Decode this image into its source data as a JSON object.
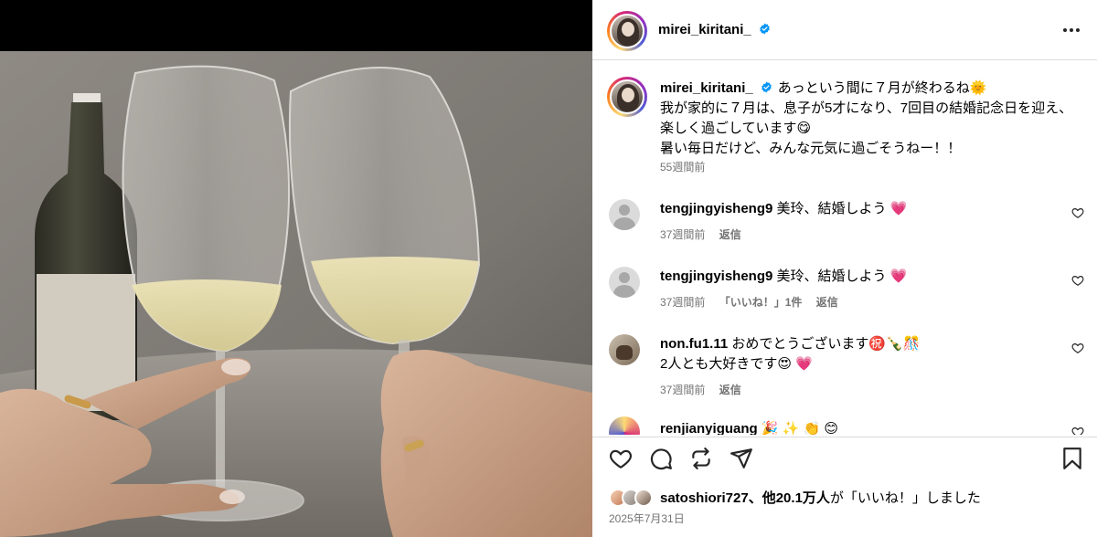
{
  "post": {
    "author": "mirei_kiritani_",
    "photo_alt": "Two wine glasses clinking with a wine bottle"
  },
  "caption": {
    "username": "mirei_kiritani_",
    "line1": "あっという間に７月が終わるね🌞",
    "line2": "我が家的に７月は、息子が5才になり、7回目の結婚記念日を迎え、楽しく過ごしています😋",
    "line3": "暑い毎日だけど、みんな元気に過ごそうねー！！",
    "time": "55週間前"
  },
  "comments": [
    {
      "username": "tengjingyisheng9",
      "text": "美玲、結婚しよう 💗",
      "time": "37週間前",
      "likes": "",
      "reply": "返信"
    },
    {
      "username": "tengjingyisheng9",
      "text": "美玲、結婚しよう 💗",
      "time": "37週間前",
      "likes": "「いいね！」1件",
      "reply": "返信"
    },
    {
      "username": "non.fu1.11",
      "text": "おめでとうございます㊗️🍾🎊",
      "text2": "2人とも大好きです😍 💗",
      "time": "37週間前",
      "likes": "",
      "reply": "返信"
    }
  ],
  "partial_comment": {
    "username": "renjianyiguang",
    "text": "🎉 ✨ 👏 😊"
  },
  "likes": {
    "user": "satoshiori727",
    "suffix_bold": "、他20.1万人",
    "suffix": "が「いいね！」しました"
  },
  "date": "2025年7月31日",
  "colors": {
    "verified": "#0095f6",
    "heart": "#e8245b",
    "muted": "#737373",
    "border": "#dbdbdb"
  },
  "icons": [
    "verified-badge-icon",
    "more-options-icon",
    "heart-icon",
    "comment-icon",
    "repost-icon",
    "share-icon",
    "bookmark-icon"
  ]
}
